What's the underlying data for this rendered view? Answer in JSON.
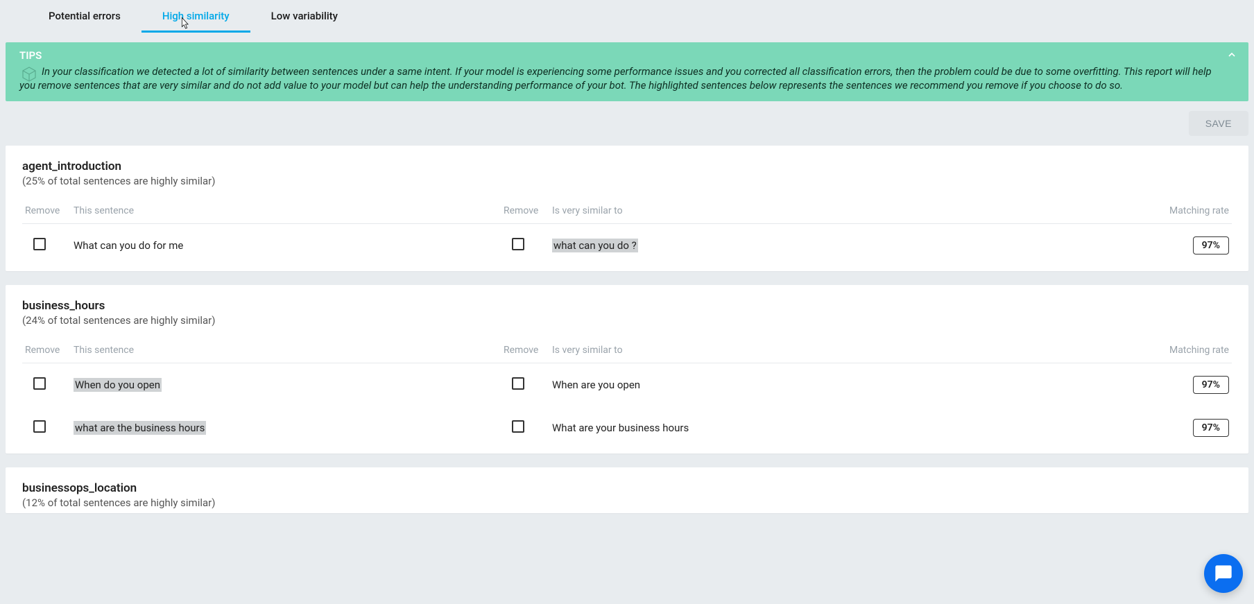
{
  "tabs": {
    "potential_errors": "Potential errors",
    "high_similarity": "High similarity",
    "low_variability": "Low variability"
  },
  "tips": {
    "title": "TIPS",
    "body": "In your classification we detected a lot of similarity between sentences under a same intent. If your model is experiencing some performance issues and you corrected all classification errors, then the problem could be due to some overfitting. This report will help you remove sentences that are very similar and do not add value to your model but can help the understanding performance of your bot. The highlighted sentences below represents the sentences we recommend you remove if you choose to do so."
  },
  "save_label": "SAVE",
  "headers": {
    "remove": "Remove",
    "this_sentence": "This sentence",
    "remove2": "Remove",
    "is_similar": "Is very similar to",
    "rate": "Matching rate"
  },
  "intents": [
    {
      "name": "agent_introduction",
      "sub": "(25% of total sentences are highly similar)",
      "rows": [
        {
          "left": "What can you do for me",
          "left_hl": false,
          "right": "what can you do ?",
          "right_hl": true,
          "rate": "97%"
        }
      ]
    },
    {
      "name": "business_hours",
      "sub": "(24% of total sentences are highly similar)",
      "rows": [
        {
          "left": "When do you open",
          "left_hl": true,
          "right": "When are you open",
          "right_hl": false,
          "rate": "97%"
        },
        {
          "left": "what are the business hours",
          "left_hl": true,
          "right": "What are your business hours",
          "right_hl": false,
          "rate": "97%"
        }
      ]
    },
    {
      "name": "businessops_location",
      "sub": "(12% of total sentences are highly similar)",
      "rows": []
    }
  ]
}
